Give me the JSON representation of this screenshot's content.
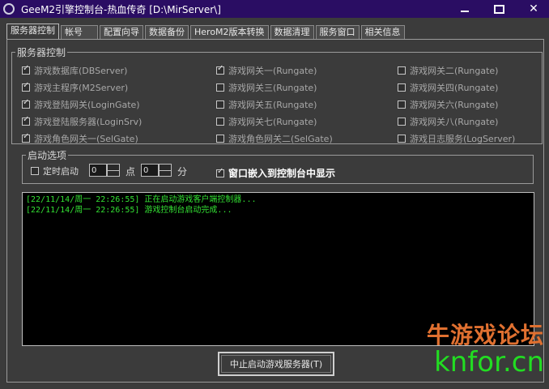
{
  "window": {
    "title": "GeeM2引擎控制台-热血传奇 [D:\\MirServer\\]"
  },
  "tabs": [
    {
      "label": "服务器控制",
      "active": true
    },
    {
      "label": "帐号",
      "active": false
    },
    {
      "label": "配置向导",
      "active": false
    },
    {
      "label": "数据备份",
      "active": false
    },
    {
      "label": "HeroM2版本转换",
      "active": false
    },
    {
      "label": "数据清理",
      "active": false
    },
    {
      "label": "服务窗口",
      "active": false
    },
    {
      "label": "相关信息",
      "active": false
    }
  ],
  "server_control": {
    "title": "服务器控制",
    "checkboxes": [
      {
        "label": "游戏数据库(DBServer)",
        "checked": true
      },
      {
        "label": "游戏主程序(M2Server)",
        "checked": true
      },
      {
        "label": "游戏登陆网关(LoginGate)",
        "checked": true
      },
      {
        "label": "游戏登陆服务器(LoginSrv)",
        "checked": true
      },
      {
        "label": "游戏角色网关一(SelGate)",
        "checked": true
      },
      {
        "label": "游戏网关一(Rungate)",
        "checked": true
      },
      {
        "label": "游戏网关三(Rungate)",
        "checked": false
      },
      {
        "label": "游戏网关五(Rungate)",
        "checked": false
      },
      {
        "label": "游戏网关七(Rungate)",
        "checked": false
      },
      {
        "label": "游戏角色网关二(SelGate)",
        "checked": false
      },
      {
        "label": "游戏网关二(Rungate)",
        "checked": false
      },
      {
        "label": "游戏网关四(Rungate)",
        "checked": false
      },
      {
        "label": "游戏网关六(Rungate)",
        "checked": false
      },
      {
        "label": "游戏网关八(Rungate)",
        "checked": false
      },
      {
        "label": "游戏日志服务(LogServer)",
        "checked": false
      }
    ]
  },
  "startup": {
    "title": "启动选项",
    "timed_label": "定时启动",
    "timed_checked": false,
    "hour_value": "0",
    "hour_unit": "点",
    "minute_value": "0",
    "minute_unit": "分",
    "embed_label": "窗口嵌入到控制台中显示",
    "embed_checked": true
  },
  "log": {
    "lines": [
      "[22/11/14/周一 22:26:55] 正在启动游戏客户端控制器...",
      "[22/11/14/周一 22:26:55] 游戏控制台启动完成..."
    ]
  },
  "actions": {
    "stop_label": "中止启动游戏服务器(T)"
  },
  "watermark": {
    "line1": "牛游戏论坛",
    "line2": "knfor.cn"
  },
  "colors": {
    "titlebar": "#2a0d63",
    "background": "#3b3b3b",
    "log_bg": "#000000",
    "log_text": "#33e033"
  }
}
